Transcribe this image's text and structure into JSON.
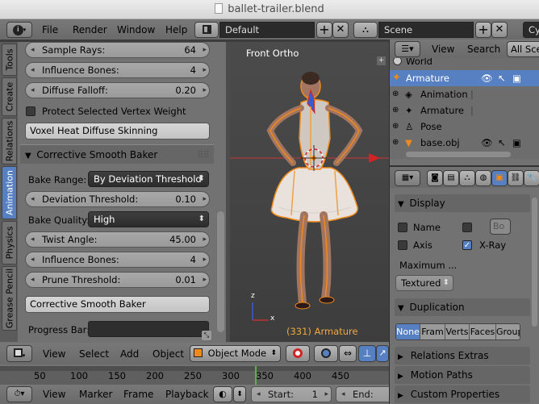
{
  "window": {
    "title": "ballet-trailer.blend"
  },
  "info_header": {
    "menus": [
      "File",
      "Render",
      "Window",
      "Help"
    ],
    "layout": "Default",
    "scene": "Scene",
    "engine_partial": "Cy"
  },
  "toolshelf": {
    "tabs": [
      "Tools",
      "Create",
      "Relations",
      "Animation",
      "Physics",
      "Grease Pencil"
    ],
    "active_tab": "Animation",
    "sample_rays": {
      "label": "Sample Rays:",
      "value": "64"
    },
    "influence_bones_1": {
      "label": "Influence Bones:",
      "value": "4"
    },
    "diffuse_falloff": {
      "label": "Diffuse Falloff:",
      "value": "0.20"
    },
    "protect_vertex_weight": "Protect Selected Vertex Weight",
    "voxel_button": "Voxel Heat Diffuse Skinning",
    "section_title": "Corrective Smooth Baker",
    "bake_range": {
      "label": "Bake Range:",
      "value": "By Deviation Threshold"
    },
    "deviation_threshold": {
      "label": "Deviation Threshold:",
      "value": "0.10"
    },
    "bake_quality": {
      "label": "Bake Quality:",
      "value": "High"
    },
    "twist_angle": {
      "label": "Twist Angle:",
      "value": "45.00"
    },
    "influence_bones_2": {
      "label": "Influence Bones:",
      "value": "4"
    },
    "prune_threshold": {
      "label": "Prune Threshold:",
      "value": "0.01"
    },
    "bake_button": "Corrective Smooth Baker",
    "progress_label": "Progress Bar:"
  },
  "viewport": {
    "view_label": "Front Ortho",
    "object_label": "(331) Armature",
    "axis_z": "z",
    "axis_x": "x"
  },
  "viewport_header": {
    "menus": [
      "View",
      "Select",
      "Add",
      "Object"
    ],
    "mode": "Object Mode"
  },
  "outliner": {
    "header": {
      "menus": [
        "View",
        "Search"
      ],
      "filter": "All Sce"
    },
    "rows": [
      {
        "label": "World",
        "indent": 0
      },
      {
        "label": "Armature",
        "indent": 0,
        "selected": true
      },
      {
        "label": "Animation",
        "indent": 1
      },
      {
        "label": "Armature",
        "indent": 1
      },
      {
        "label": "Pose",
        "indent": 1
      },
      {
        "label": "base.obj",
        "indent": 0
      }
    ]
  },
  "properties": {
    "display": {
      "title": "Display",
      "name": "Name",
      "bo": "Bo",
      "axis": "Axis",
      "xray": "X-Ray",
      "maximum": "Maximum ...",
      "draw_type": "Textured"
    },
    "duplication": {
      "title": "Duplication",
      "options": [
        "None",
        "Fram",
        "Verts",
        "Faces",
        "Group"
      ],
      "active": "None"
    },
    "collapsed_panels": [
      "Relations Extras",
      "Motion Paths",
      "Custom Properties"
    ]
  },
  "timeline": {
    "ticks": [
      "50",
      "100",
      "150",
      "200",
      "250",
      "300",
      "350",
      "400",
      "450"
    ],
    "current_frame": 331,
    "menus": [
      "View",
      "Marker",
      "Frame",
      "Playback"
    ],
    "start": {
      "label": "Start:",
      "value": "1"
    },
    "end": {
      "label": "End:"
    }
  },
  "colors": {
    "accent_blue": "#5680c2",
    "selected_orange": "#f08a1c",
    "panel_gray": "#727272",
    "dark_field": "#2a2a2a"
  }
}
